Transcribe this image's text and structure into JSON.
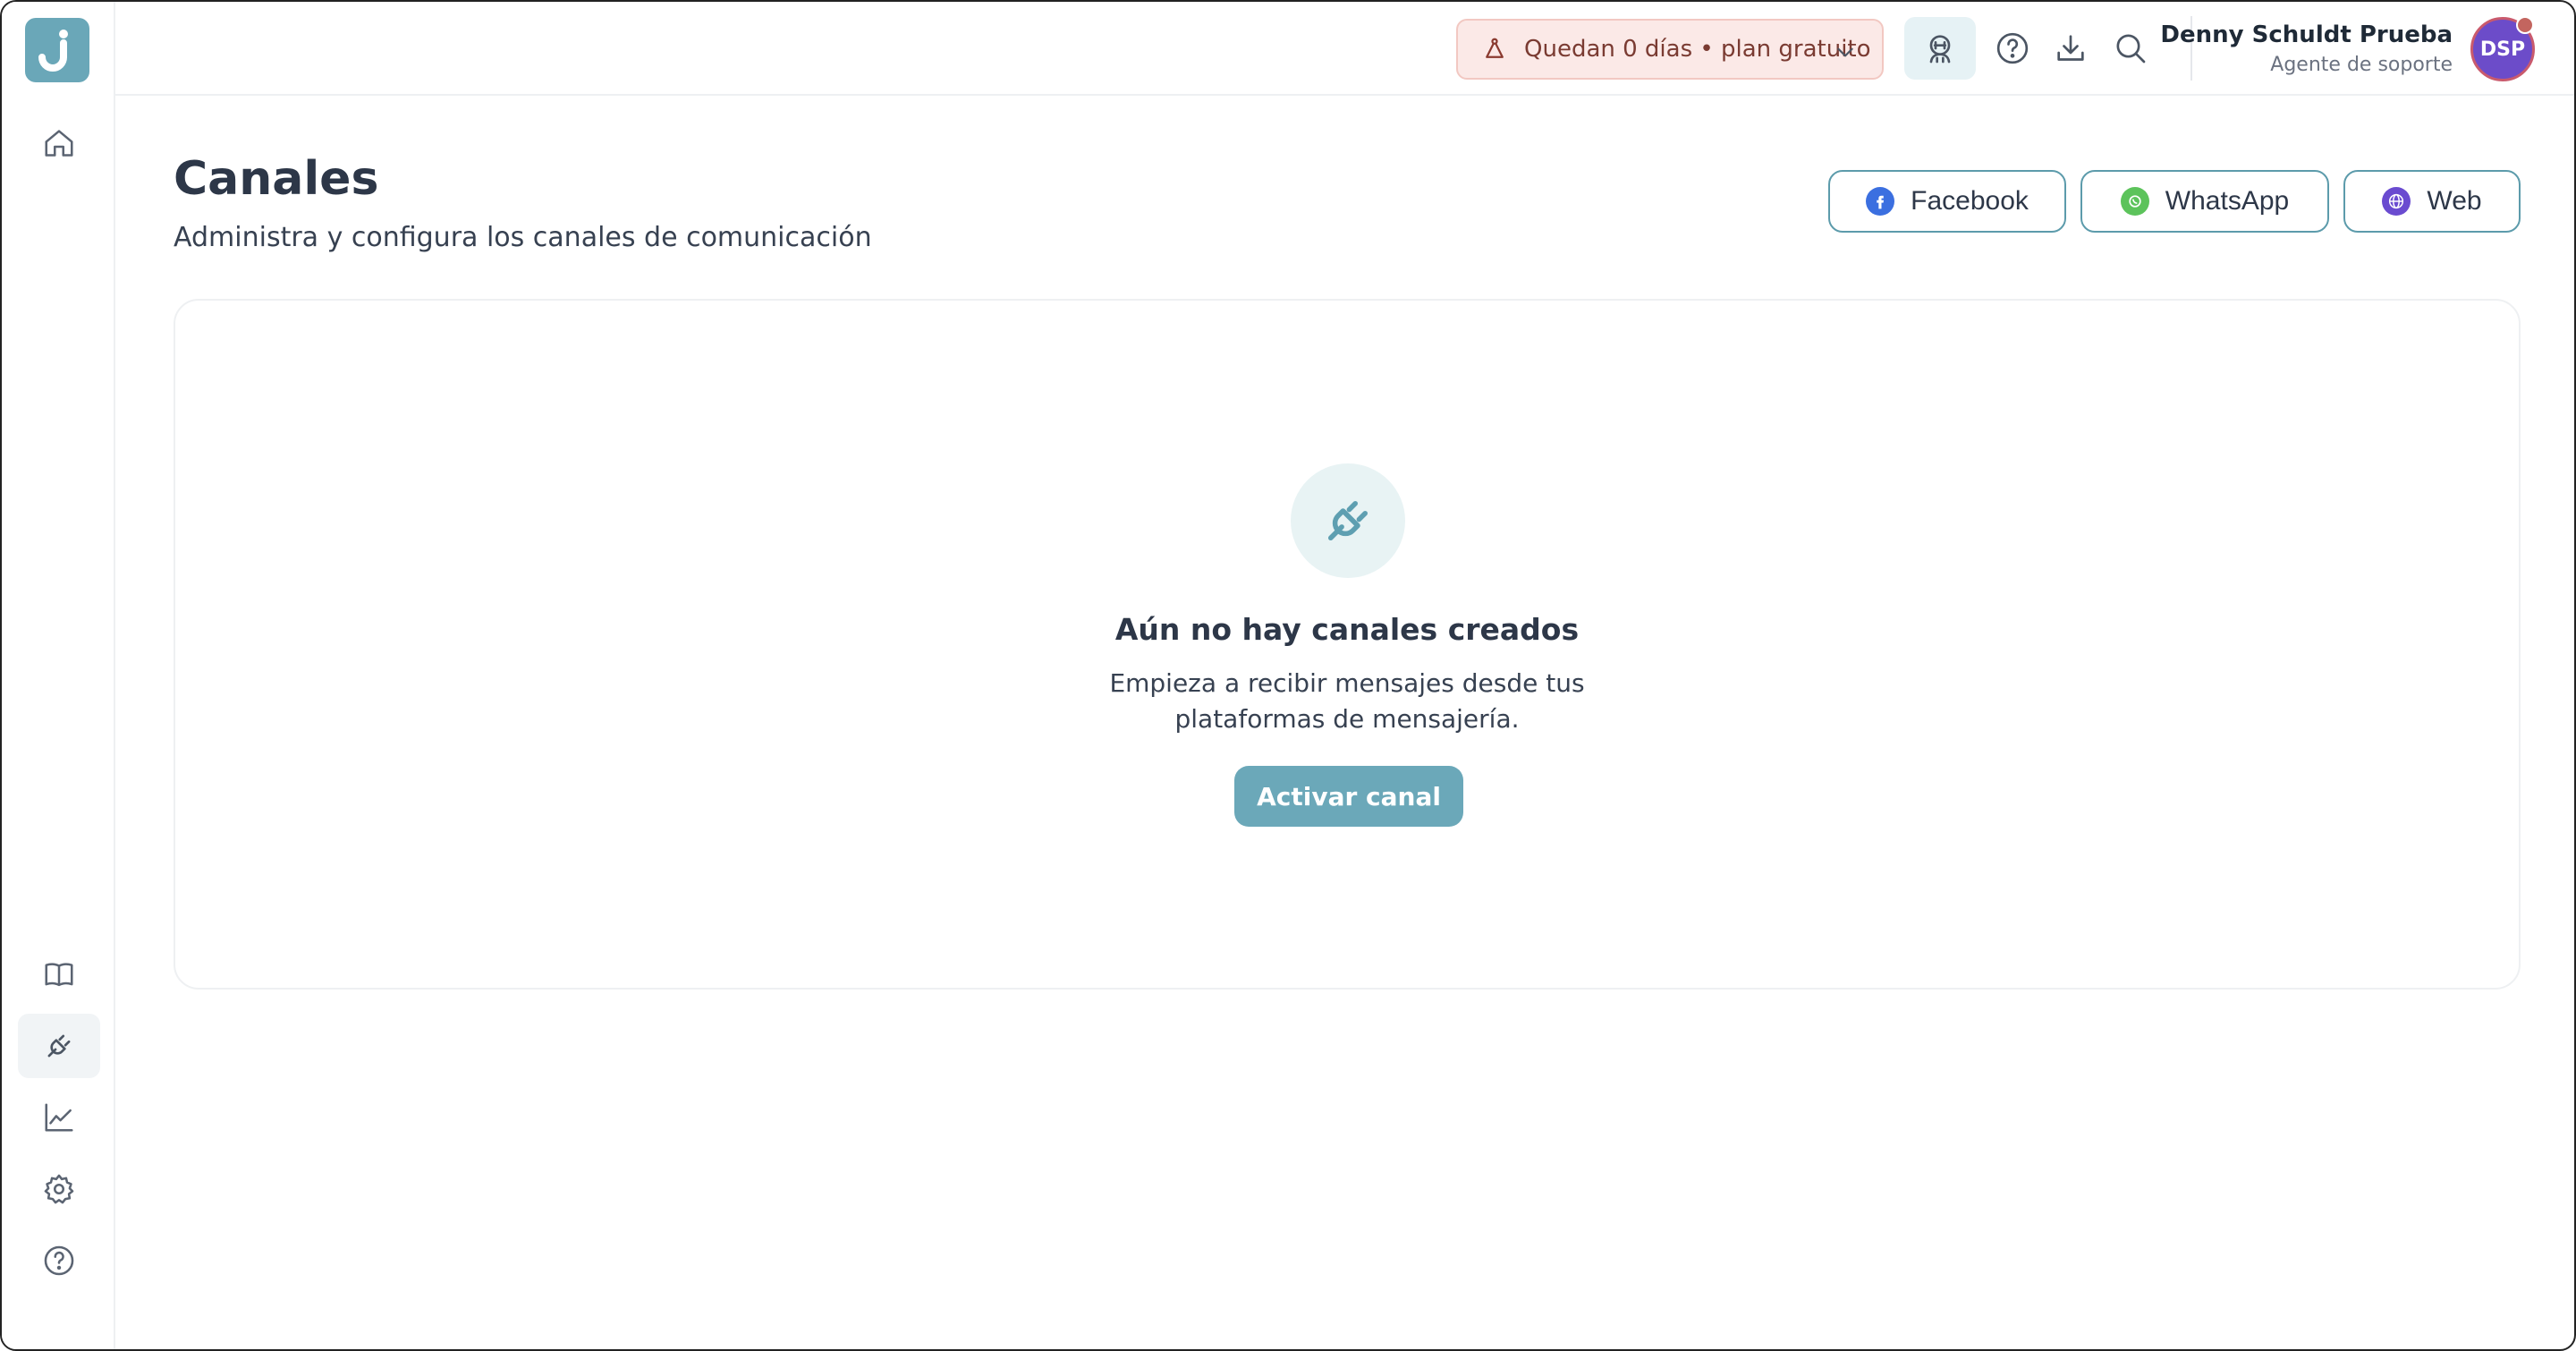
{
  "app": {
    "logo_letter": "J"
  },
  "topbar": {
    "plan_text": "Quedan 0 días • plan gratuito",
    "user_name": "Denny Schuldt Prueba",
    "user_role": "Agente de soporte",
    "avatar_initials": "DSP"
  },
  "header": {
    "title": "Canales",
    "subtitle": "Administra y configura los canales de comunicación"
  },
  "channels": [
    {
      "label": "Facebook",
      "icon": "facebook-icon",
      "color": "#3b6fe0"
    },
    {
      "label": "WhatsApp",
      "icon": "whatsapp-icon",
      "color": "#5cc35b"
    },
    {
      "label": "Web",
      "icon": "globe-icon",
      "color": "#6a4bd0"
    }
  ],
  "empty_state": {
    "title": "Aún no hay canales creados",
    "text": "Empieza a recibir mensajes desde tus plataformas de mensajería.",
    "button": "Activar canal"
  },
  "colors": {
    "accent": "#6ba8b9",
    "plan_bg": "#fbe9e7",
    "avatar": "#6c4cc9"
  }
}
